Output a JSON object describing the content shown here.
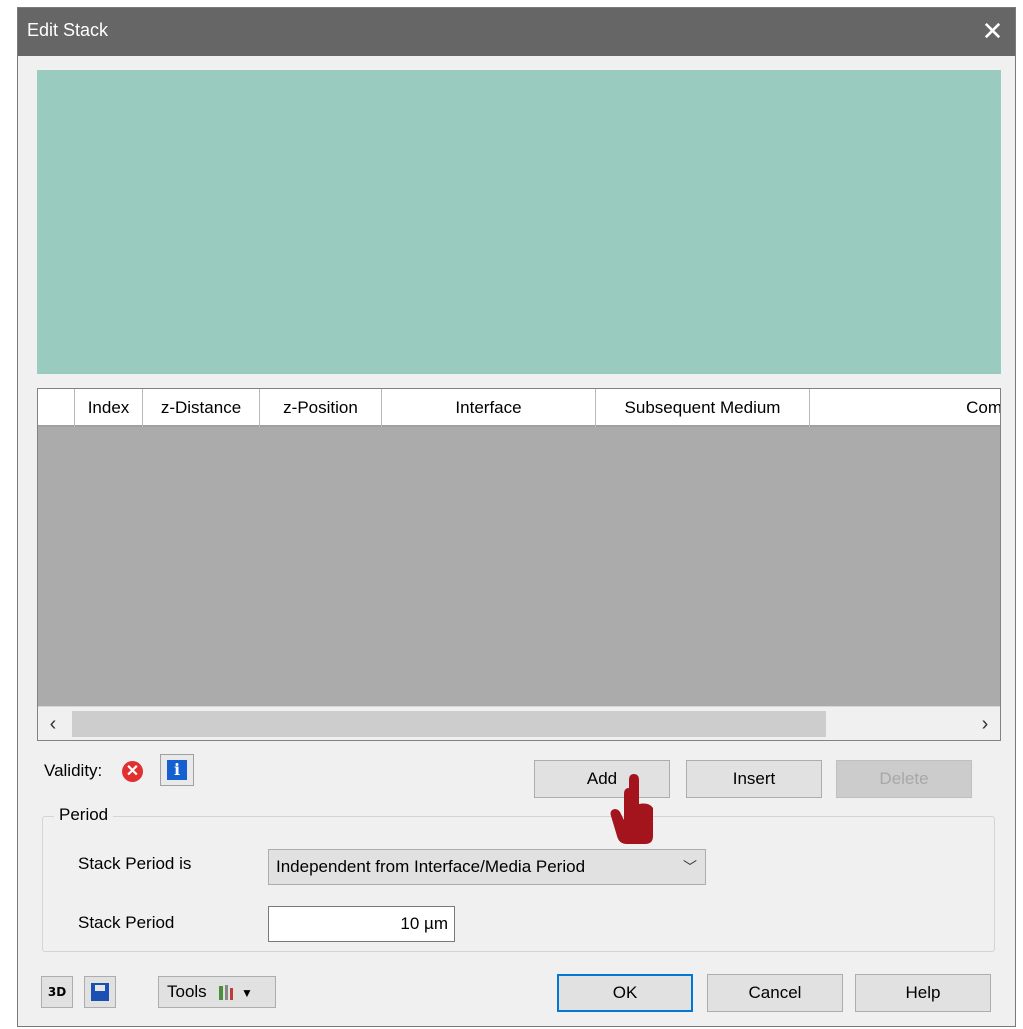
{
  "window": {
    "title": "Edit Stack"
  },
  "grid": {
    "columns": [
      "",
      "Index",
      "z-Distance",
      "z-Position",
      "Interface",
      "Subsequent Medium",
      "Com"
    ]
  },
  "validity": {
    "label": "Validity:",
    "status": "invalid"
  },
  "actions": {
    "add": "Add",
    "insert": "Insert",
    "delete": "Delete"
  },
  "period": {
    "group_title": "Period",
    "stack_period_is_label": "Stack Period is",
    "stack_period_is_value": "Independent from Interface/Media Period",
    "stack_period_label": "Stack Period",
    "stack_period_value": "10 µm"
  },
  "footer": {
    "tools": "Tools",
    "ok": "OK",
    "cancel": "Cancel",
    "help": "Help"
  },
  "colors": {
    "preview": "#99cbbf",
    "grid_bg": "#ababab",
    "titlebar": "#666666",
    "cursor": "#a3141c"
  }
}
